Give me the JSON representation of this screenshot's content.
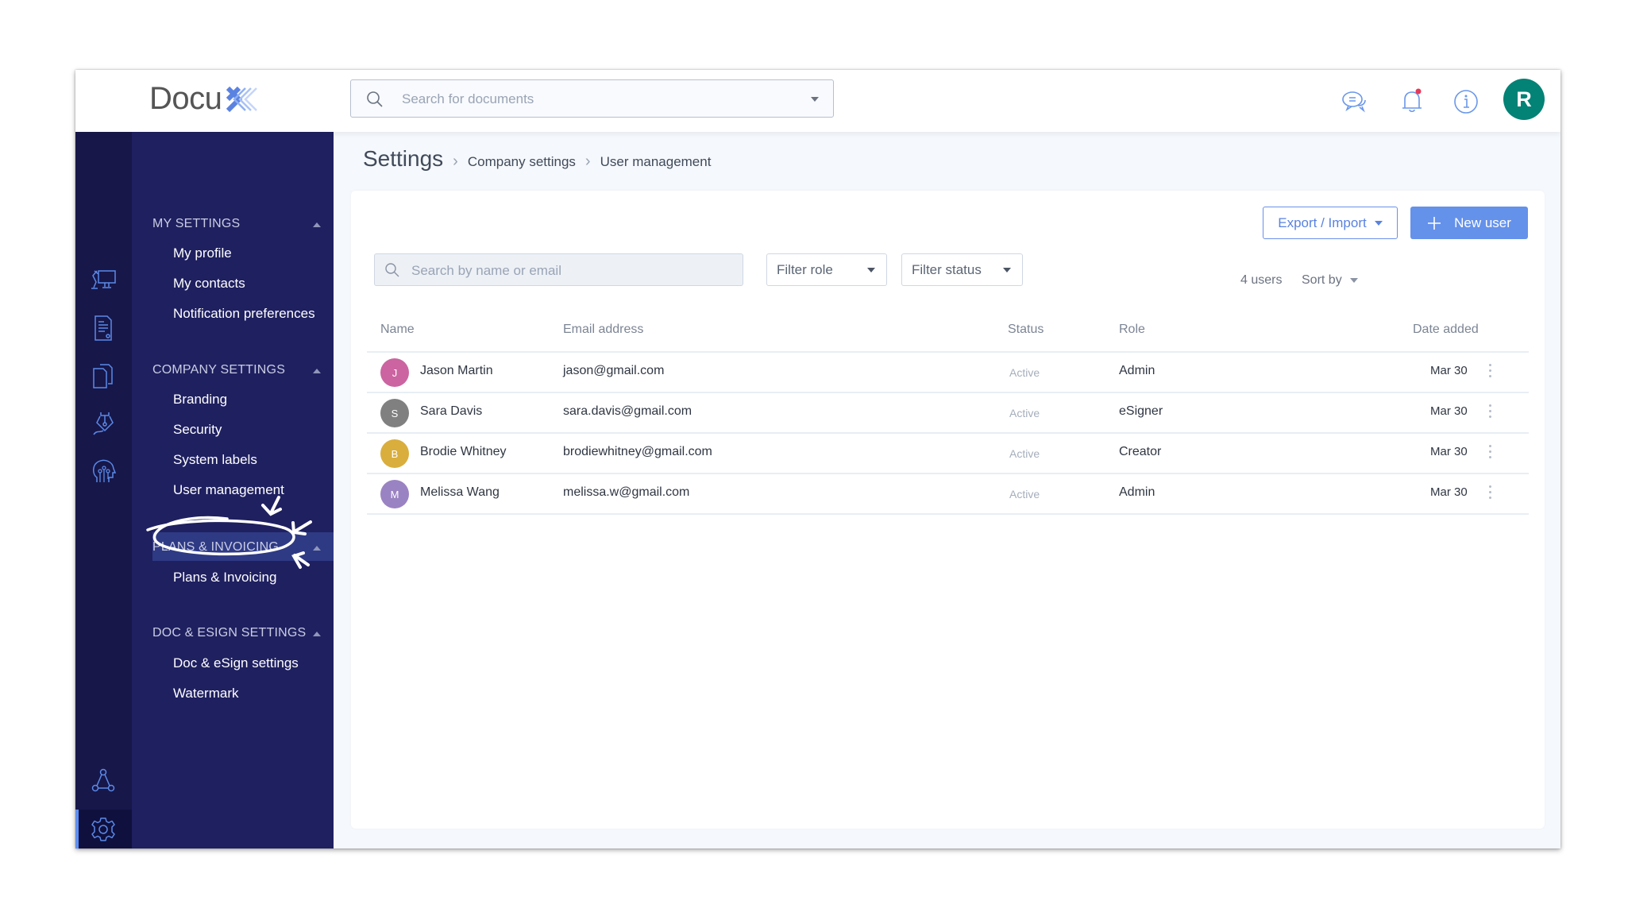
{
  "app": {
    "logo_text": "Docu",
    "logo_accent": "X",
    "brand_color": "#6491ea"
  },
  "header": {
    "search_placeholder": "Search for documents",
    "icons": [
      "chat-icon",
      "bell-icon",
      "info-icon"
    ],
    "notification_dot_color": "#e5395a",
    "avatar_initial": "R",
    "avatar_color": "#038276"
  },
  "rail": {
    "icons": [
      "desk-workspace-icon",
      "document-icon",
      "copy-documents-icon",
      "pen-nib-icon",
      "ai-head-icon",
      "network-icon",
      "settings-gear-icon"
    ],
    "active": "settings-gear-icon"
  },
  "nav": {
    "sections": [
      {
        "title": "MY SETTINGS",
        "items": [
          "My profile",
          "My contacts",
          "Notification preferences"
        ]
      },
      {
        "title": "COMPANY SETTINGS",
        "items": [
          "Branding",
          "Security",
          "System labels",
          "User management"
        ]
      },
      {
        "title": "PLANS & INVOICING",
        "items": [
          "Plans & Invoicing"
        ]
      },
      {
        "title": "DOC & ESIGN SETTINGS",
        "items": [
          "Doc & eSign settings",
          "Watermark"
        ]
      }
    ],
    "active_item": "User management"
  },
  "breadcrumb": {
    "root": "Settings",
    "level1": "Company settings",
    "level2": "User management"
  },
  "toolbar": {
    "export_label": "Export / Import",
    "new_user_label": "New user",
    "search_placeholder": "Search by name or email",
    "filter_role": "Filter role",
    "filter_status": "Filter status",
    "user_count": "4 users",
    "sort_label": "Sort by"
  },
  "table": {
    "columns": [
      "Name",
      "Email address",
      "Status",
      "Role",
      "Date added"
    ],
    "rows": [
      {
        "initial": "J",
        "avatar_color": "#cb64a0",
        "name": "Jason Martin",
        "email": "jason@gmail.com",
        "status": "Active",
        "role": "Admin",
        "date": "Mar 30"
      },
      {
        "initial": "S",
        "avatar_color": "#808080",
        "name": "Sara Davis",
        "email": "sara.davis@gmail.com",
        "status": "Active",
        "role": "eSigner",
        "date": "Mar 30"
      },
      {
        "initial": "B",
        "avatar_color": "#d9ae3d",
        "name": "Brodie Whitney",
        "email": "brodiewhitney@gmail.com",
        "status": "Active",
        "role": "Creator",
        "date": "Mar 30"
      },
      {
        "initial": "M",
        "avatar_color": "#9a83c2",
        "name": "Melissa Wang",
        "email": "melissa.w@gmail.com",
        "status": "Active",
        "role": "Admin",
        "date": "Mar 30"
      }
    ]
  }
}
